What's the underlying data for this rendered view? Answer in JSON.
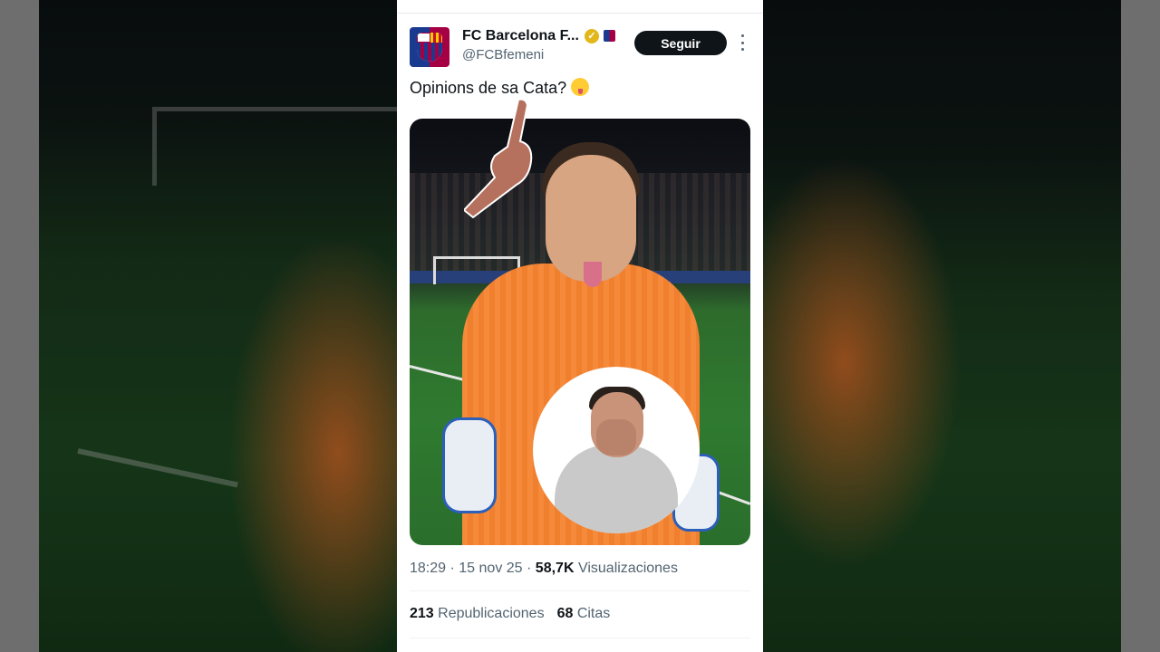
{
  "tweet": {
    "author_name": "FC Barcelona F...",
    "handle": "@FCBfemeni",
    "follow_label": "Seguir",
    "text": "Opinions de sa Cata?",
    "time": "18:29",
    "date": "15 nov 25",
    "views_count": "58,7K",
    "views_label": "Visualizaciones",
    "reposts_count": "213",
    "reposts_label": "Republicaciones",
    "quotes_count": "68",
    "quotes_label": "Citas",
    "separator": "·"
  },
  "icons": {
    "verified": "verified-badge-icon",
    "affiliate": "affiliate-badge-icon",
    "more": "more-options-icon",
    "emoji": "winking-tongue-emoji",
    "pointer": "pointing-hand-icon"
  },
  "colors": {
    "follow_bg": "#0f1419",
    "verified_gold": "#e2b719",
    "secondary_text": "#536471",
    "barca_blue": "#1a3a8f",
    "barca_red": "#a50044",
    "jersey_orange": "#f58a3a"
  }
}
